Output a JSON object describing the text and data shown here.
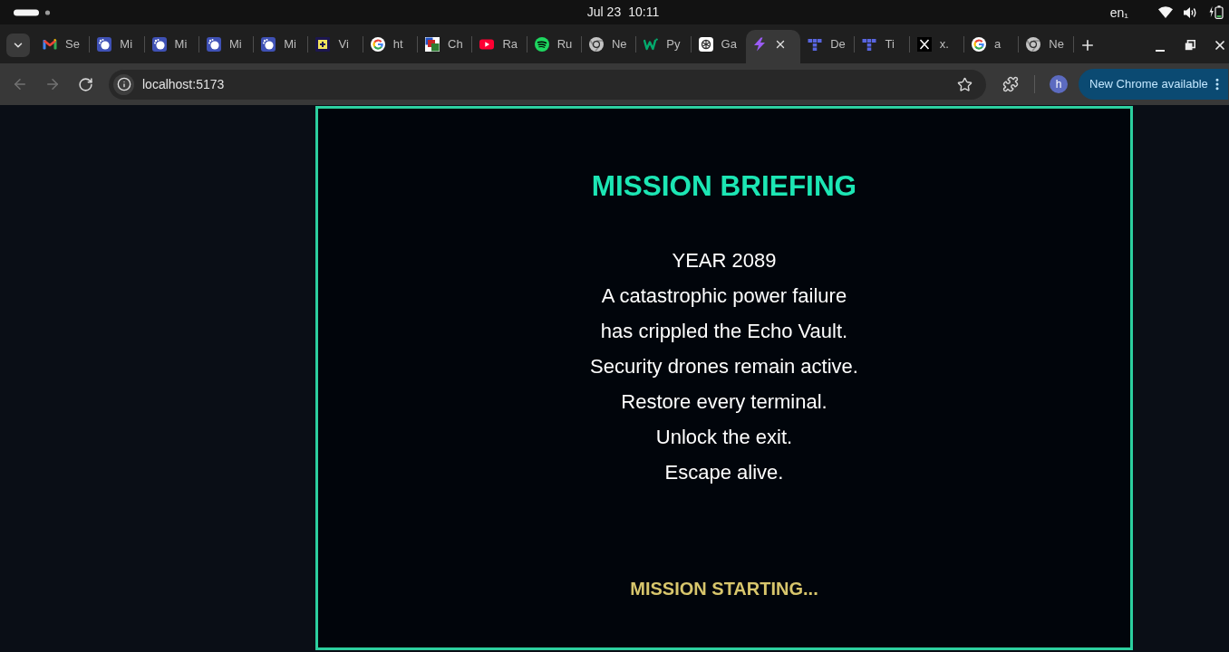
{
  "system_bar": {
    "date": "Jul 23",
    "time": "10:11",
    "keyboard_layout": "en₁"
  },
  "tab_strip": {
    "tabs": [
      {
        "kind": "mletter",
        "title": "Se",
        "selected": false
      },
      {
        "kind": "robot",
        "title": "Mi",
        "selected": false
      },
      {
        "kind": "robot",
        "title": "Mi",
        "selected": false
      },
      {
        "kind": "robot",
        "title": "Mi",
        "selected": false
      },
      {
        "kind": "robot",
        "title": "Mi",
        "selected": false
      },
      {
        "kind": "plusbox",
        "title": "Vi",
        "selected": false
      },
      {
        "kind": "gletter",
        "title": "ht",
        "selected": false
      },
      {
        "kind": "squares",
        "title": "Ch",
        "selected": false
      },
      {
        "kind": "play",
        "title": "Ra",
        "selected": false
      },
      {
        "kind": "spotify",
        "title": "Ru",
        "selected": false
      },
      {
        "kind": "ring",
        "title": "Ne",
        "selected": false
      },
      {
        "kind": "wletter",
        "title": "Py",
        "selected": false
      },
      {
        "kind": "knot",
        "title": "Ga",
        "selected": false
      },
      {
        "kind": "bolt",
        "selected": true
      },
      {
        "kind": "tblocks",
        "title": "De",
        "selected": false
      },
      {
        "kind": "tblocks",
        "title": "Ti",
        "selected": false
      },
      {
        "kind": "xletter",
        "title": "x.",
        "selected": false
      },
      {
        "kind": "gletter",
        "title": "a",
        "selected": false
      },
      {
        "kind": "ring",
        "title": "Ne",
        "selected": false
      }
    ]
  },
  "toolbar": {
    "back": {
      "disabled": true
    },
    "forward": {
      "disabled": true
    },
    "address": "localhost:5173",
    "profile_initial": "h",
    "update_button": "New Chrome available"
  },
  "briefing": {
    "title": "MISSION BRIEFING",
    "lines": [
      "YEAR 2089",
      "A catastrophic power failure",
      "has crippled the Echo Vault.",
      "Security drones remain active.",
      "Restore every terminal.",
      "Unlock the exit.",
      "Escape alive."
    ],
    "status": "MISSION STARTING..."
  }
}
